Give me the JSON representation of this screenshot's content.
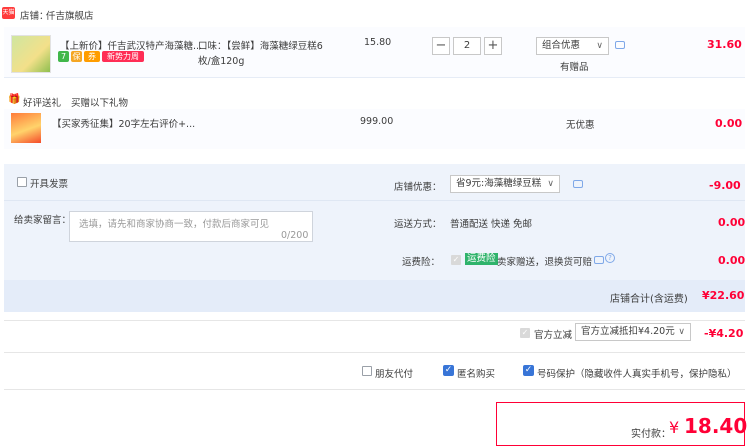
{
  "shop": {
    "logo_text": "天猫",
    "label": "店铺：",
    "name": "仟吉旗舰店"
  },
  "item": {
    "title": "【上新价】仟吉武汉特产海藻糖...",
    "badges": [
      "7",
      "保",
      "券"
    ],
    "promo_badge": "新势力周",
    "sku_line1": "口味：【尝鲜】海藻糖绿豆糕6",
    "sku_line2": "枚/盒120g",
    "price": "15.80",
    "qty": "2",
    "minus": "−",
    "plus": "+",
    "discount_select": "组合优惠",
    "gift_note": "有赠品",
    "subtotal": "31.60"
  },
  "gift": {
    "header_label": "好评送礼",
    "header_sub": "买赠以下礼物",
    "title": "【买家秀征集】20字左右评价+...",
    "price": "999.00",
    "discount": "无优惠",
    "subtotal": "0.00"
  },
  "invoice": {
    "label": "开具发票"
  },
  "message": {
    "label": "给卖家留言：",
    "placeholder": "选填，请先和商家协商一致，付款后商家可见",
    "counter": "0/200"
  },
  "shop_coupon": {
    "label": "店铺优惠：",
    "value": "省9元:海藻糖绿豆糕",
    "amount": "-9.00"
  },
  "shipping": {
    "label": "运送方式：",
    "value": "普通配送 快递 免邮",
    "amount": "0.00"
  },
  "insurance": {
    "label": "运费险：",
    "badge": "运费险",
    "value": "卖家赠送，退换货可赔",
    "amount": "0.00"
  },
  "shop_total": {
    "label": "店铺合计(含运费)",
    "amount": "¥22.60"
  },
  "instant_discount": {
    "label": "官方立减",
    "select": "官方立减抵扣¥4.20元",
    "amount": "-¥4.20"
  },
  "options": [
    {
      "label": "朋友代付",
      "checked": false
    },
    {
      "label": "匿名购买",
      "checked": true
    },
    {
      "label": "号码保护（隐藏收件人真实手机号，保护隐私）",
      "checked": true
    }
  ],
  "pay": {
    "label": "实付款：",
    "currency": "¥",
    "amount": "18.40"
  },
  "colors": {
    "accent": "#ff0036",
    "panel": "#eef3fb",
    "total_row": "#e4ecf9",
    "check": "#3875d7"
  }
}
